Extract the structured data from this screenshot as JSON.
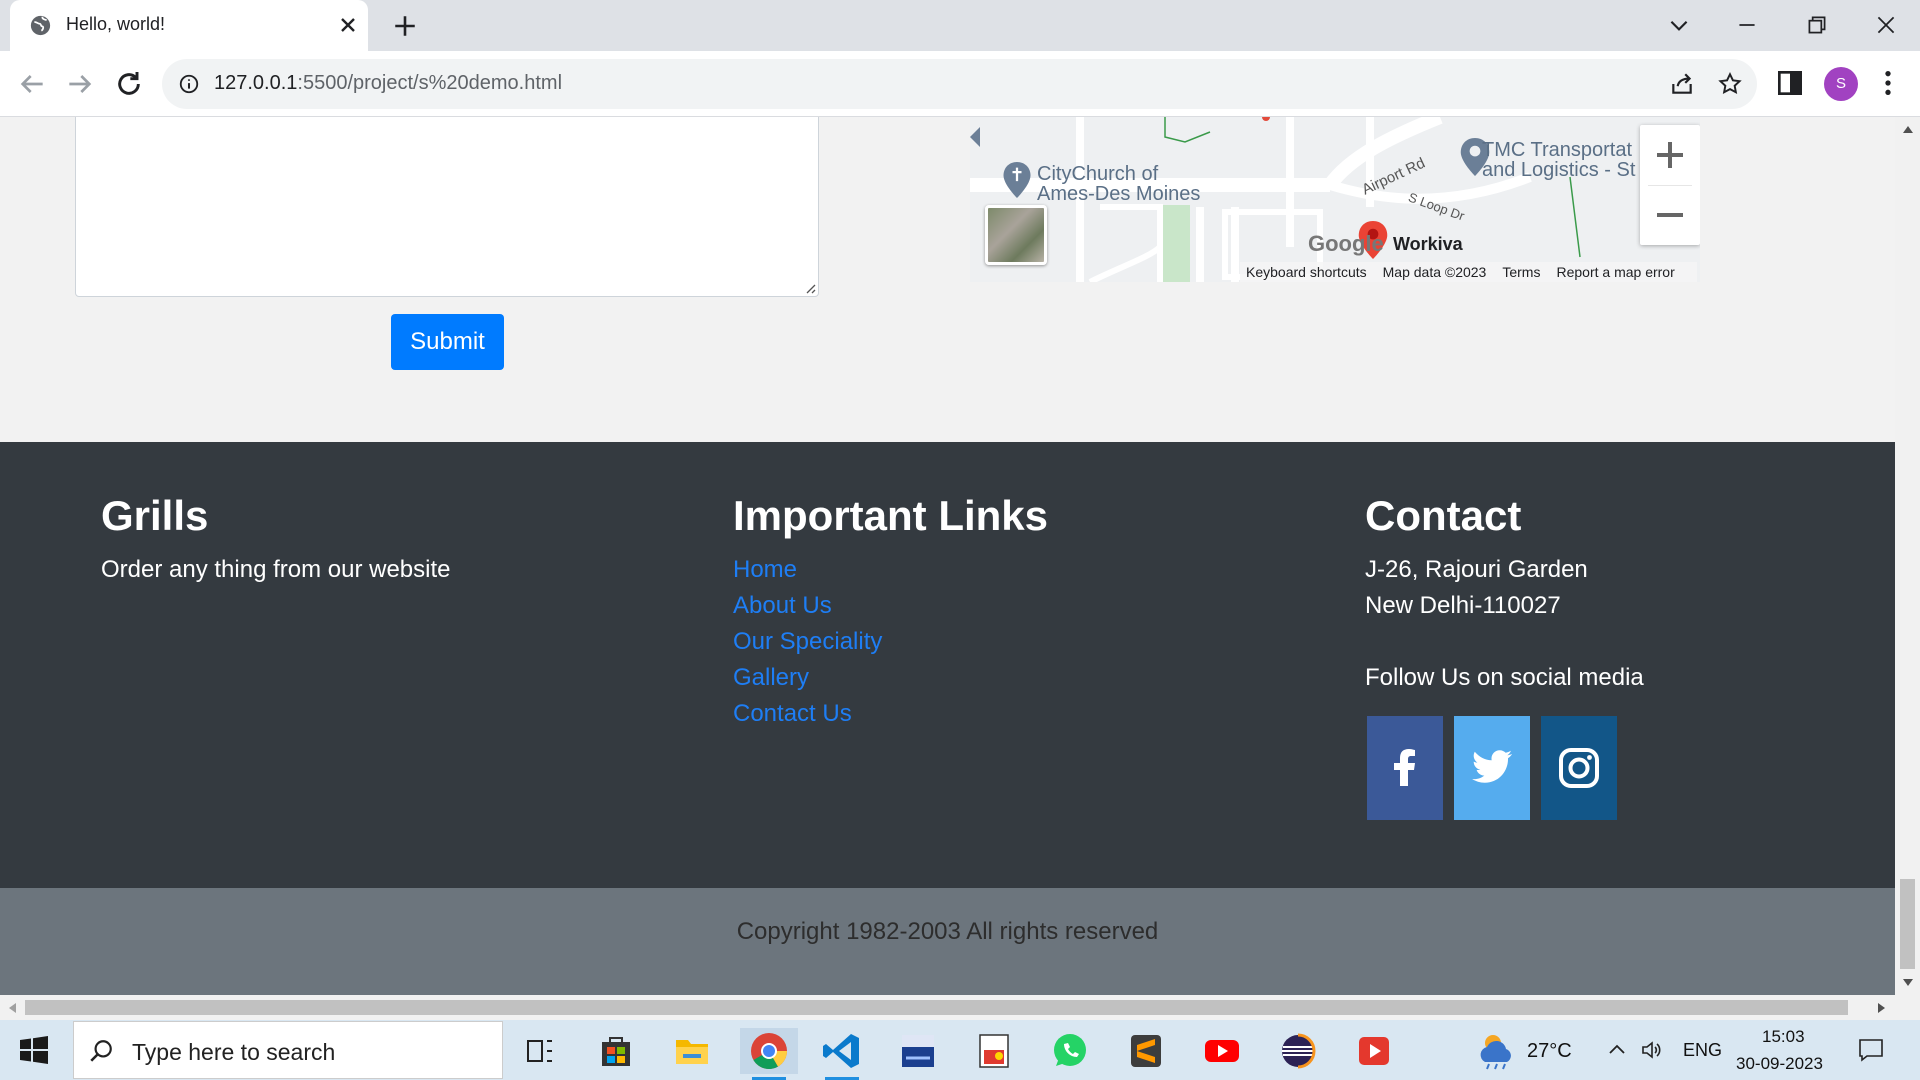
{
  "browser": {
    "tab_title": "Hello, world!",
    "url_host": "127.0.0.1",
    "url_rest": ":5500/project/s%20demo.html",
    "profile_initial": "S"
  },
  "form": {
    "submit_label": "Submit"
  },
  "map": {
    "places": {
      "church_line1": "CityChurch of",
      "church_line2": "Ames-Des Moines",
      "tmc_line1": "TMC Transportat",
      "tmc_line2": "and Logistics - St",
      "workiva": "Workiva",
      "airport_rd": "Airport Rd",
      "loop_dr": "S Loop Dr"
    },
    "google_logo": "Google",
    "footer_links": [
      "Keyboard shortcuts",
      "Map data ©2023",
      "Terms",
      "Report a map error"
    ]
  },
  "footer": {
    "grills": {
      "heading": "Grills",
      "text": "Order any thing from our website"
    },
    "links": {
      "heading": "Important Links",
      "items": [
        "Home",
        "About Us",
        "Our Speciality",
        "Gallery",
        "Contact Us"
      ]
    },
    "contact": {
      "heading": "Contact",
      "address_line1": "J-26, Rajouri Garden",
      "address_line2": "New Delhi-110027",
      "follow": "Follow Us on social media"
    },
    "social_colors": {
      "facebook": "#3b5998",
      "twitter": "#55acee",
      "instagram": "#125688"
    },
    "copyright": "Copyright 1982-2003 All rights reserved"
  },
  "taskbar": {
    "search_placeholder": "Type here to search",
    "weather": "27°C",
    "language": "ENG",
    "time": "15:03",
    "date": "30-09-2023"
  }
}
